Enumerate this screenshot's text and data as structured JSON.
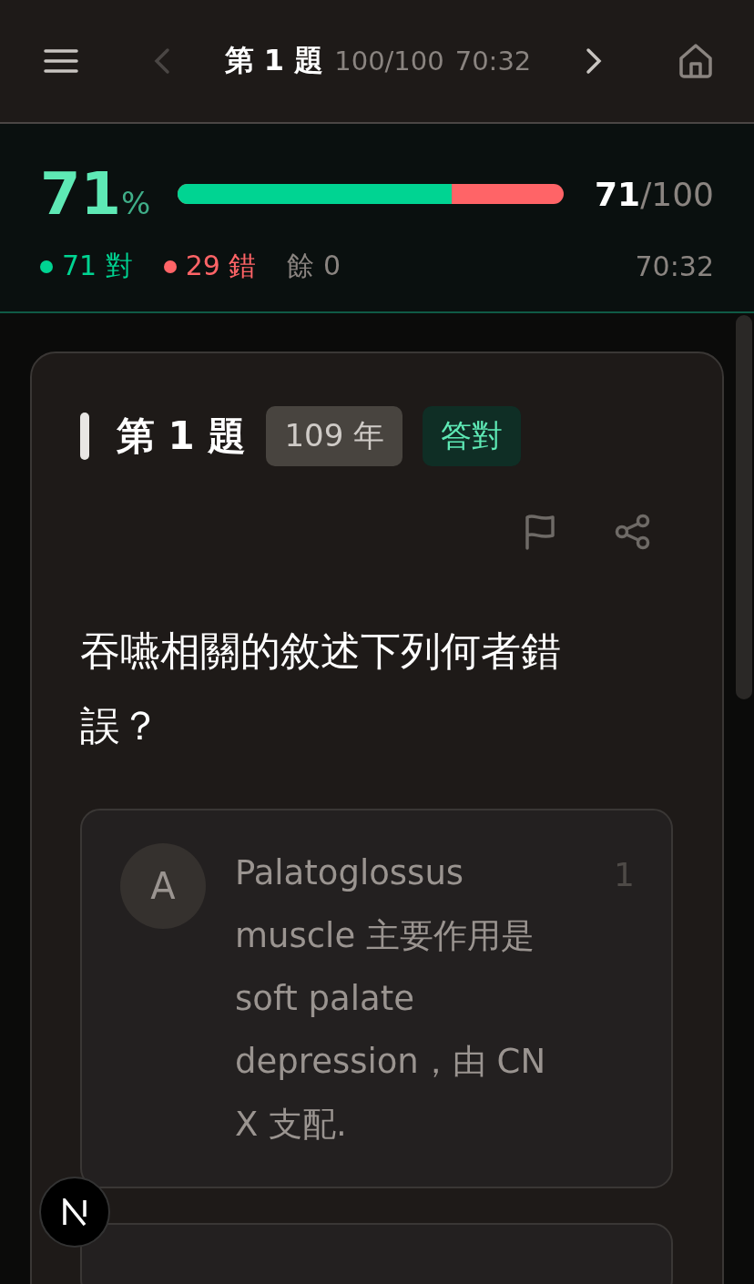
{
  "header": {
    "title": "第 1 題",
    "progress": "100/100",
    "time": "70:32",
    "prev_disabled": true,
    "next_disabled": false
  },
  "stats": {
    "percent": "71",
    "percent_sign": "%",
    "level": 0.71,
    "score": "71",
    "total": "/100",
    "timer": "70:32",
    "legend": [
      {
        "kind": "dot",
        "label": "71 對",
        "color": "#00d492"
      },
      {
        "kind": "dot",
        "label": "29 錯",
        "color": "#ff6467"
      },
      {
        "kind": "plain",
        "label": "餘 0"
      }
    ]
  },
  "card": {
    "title": "第 1 題",
    "year_tag": "109 年",
    "result_tag": "答對",
    "question": "吞嚥相關的敘述下列何者錯誤？",
    "options": [
      {
        "letter": "A",
        "text": "Palatoglossus muscle 主要作用是 soft palate depression，由 CN X 支配.",
        "count": "1"
      }
    ]
  }
}
